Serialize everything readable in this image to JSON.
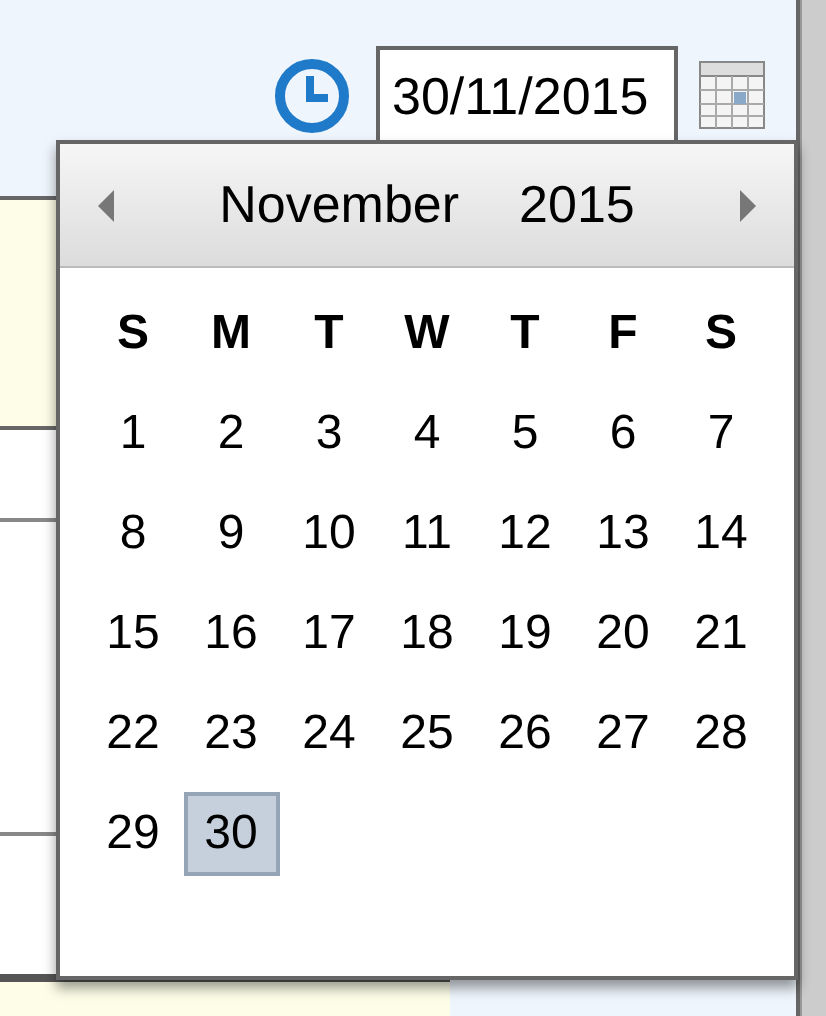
{
  "date_field": {
    "value": "30/11/2015"
  },
  "calendar": {
    "month": "November",
    "year": "2015",
    "weekdays": [
      "S",
      "M",
      "T",
      "W",
      "T",
      "F",
      "S"
    ],
    "days": [
      {
        "label": "1",
        "selected": false
      },
      {
        "label": "2",
        "selected": false
      },
      {
        "label": "3",
        "selected": false
      },
      {
        "label": "4",
        "selected": false
      },
      {
        "label": "5",
        "selected": false
      },
      {
        "label": "6",
        "selected": false
      },
      {
        "label": "7",
        "selected": false
      },
      {
        "label": "8",
        "selected": false
      },
      {
        "label": "9",
        "selected": false
      },
      {
        "label": "10",
        "selected": false
      },
      {
        "label": "11",
        "selected": false
      },
      {
        "label": "12",
        "selected": false
      },
      {
        "label": "13",
        "selected": false
      },
      {
        "label": "14",
        "selected": false
      },
      {
        "label": "15",
        "selected": false
      },
      {
        "label": "16",
        "selected": false
      },
      {
        "label": "17",
        "selected": false
      },
      {
        "label": "18",
        "selected": false
      },
      {
        "label": "19",
        "selected": false
      },
      {
        "label": "20",
        "selected": false
      },
      {
        "label": "21",
        "selected": false
      },
      {
        "label": "22",
        "selected": false
      },
      {
        "label": "23",
        "selected": false
      },
      {
        "label": "24",
        "selected": false
      },
      {
        "label": "25",
        "selected": false
      },
      {
        "label": "26",
        "selected": false
      },
      {
        "label": "27",
        "selected": false
      },
      {
        "label": "28",
        "selected": false
      },
      {
        "label": "29",
        "selected": false
      },
      {
        "label": "30",
        "selected": true
      }
    ]
  }
}
